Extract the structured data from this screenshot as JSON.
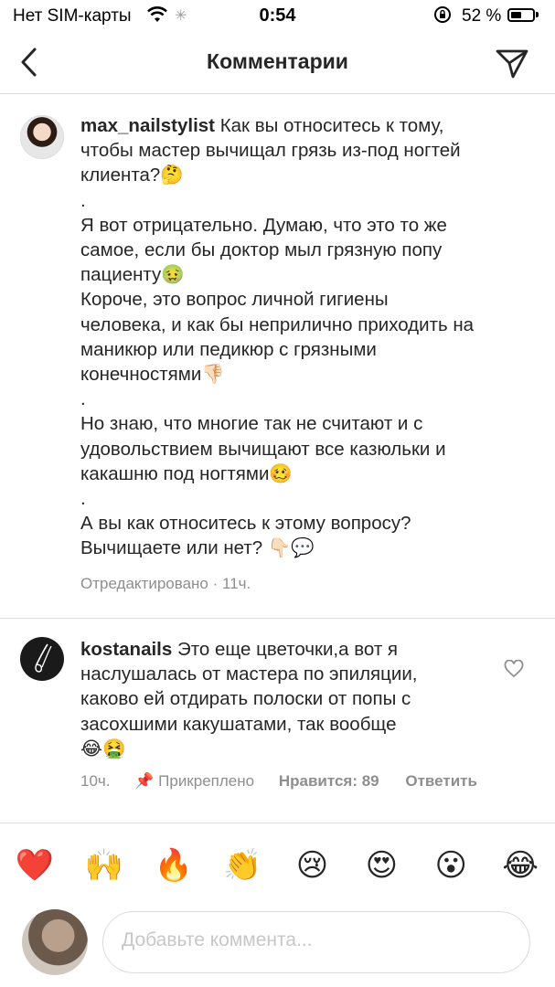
{
  "status_bar": {
    "carrier": "Нет SIM-карты",
    "time": "0:54",
    "battery_text": "52 %",
    "battery_level": 0.52
  },
  "header": {
    "title": "Комментарии"
  },
  "comments": [
    {
      "username": "max_nailstylist",
      "text": " Как вы относитесь к тому,\nчтобы мастер вычищал грязь из-под ногтей\nклиента?🤔\n.\nЯ вот отрицательно. Думаю, что это то же\nсамое, если бы доктор мыл грязную попу\nпациенту🤢\nКороче, это вопрос личной гигиены\nчеловека, и как бы неприлично приходить на\nманикюр или педикюр с грязными\nконечностями👎🏻\n.\nНо знаю, что многие так не считают и с\nудовольствием вычищают все казюльки и\nкакашню под ногтями🥴\n.\nА вы как относитесь к этому вопросу?\nВычищаете или нет? 👇🏻💬",
      "edited": "Отредактировано",
      "time": "11ч."
    },
    {
      "username": "kostanails",
      "text": " Это еще цветочки,а вот я\nнаслушалась от мастера по эпиляции,\nкаково ей отдирать полоски от попы с\nзасохшими какушатами, так вообще\n😂🤮",
      "time": "10ч.",
      "pinned": "Прикреплено",
      "likes": "Нравится: 89",
      "reply": "Ответить"
    }
  ],
  "reactions": [
    "❤️",
    "🙌",
    "🔥",
    "👏",
    "😢",
    "😍",
    "😮",
    "😂"
  ],
  "input": {
    "placeholder": "Добавьте коммента..."
  },
  "icons": {
    "back": "chevron-left-icon",
    "send": "paper-plane-icon",
    "like": "heart-outline-icon",
    "pin": "pin-icon"
  }
}
